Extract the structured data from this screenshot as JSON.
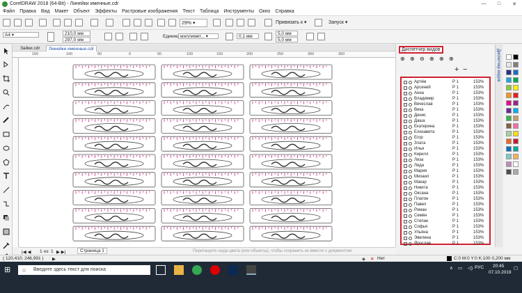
{
  "window": {
    "title": "CorelDRAW 2018 (64-Bit) - Линейки именные.cdr"
  },
  "menu": [
    "Файл",
    "Правка",
    "Вид",
    "Макет",
    "Объект",
    "Эффекты",
    "Растровые изображения",
    "Текст",
    "Таблица",
    "Инструменты",
    "Окно",
    "Справка"
  ],
  "toolbar": {
    "zoom_value": "29%",
    "snap_label": "Привязать к",
    "launch_label": "Запуск"
  },
  "propbar": {
    "page_size": "A4",
    "width": "210,0 мм",
    "height": "297,0 мм",
    "units_label": "Единицы:",
    "units_value": "миллимет...",
    "nudge": "0,1 мм",
    "dup_x": "5,0 мм",
    "dup_y": "5,0 мм"
  },
  "tabs": [
    "Зайки.cdr",
    "Линейки именные.cdr"
  ],
  "ruler_h_ticks": [
    "150",
    "100",
    "50",
    "0",
    "50",
    "100",
    "150",
    "200",
    "250",
    "300",
    "350"
  ],
  "docker": {
    "title": "Диспетчер видов",
    "side_tab": "Диспетчер видов",
    "rows": [
      {
        "name": "Артём",
        "page": "Р 1",
        "zoom": "153%"
      },
      {
        "name": "Арсений",
        "page": "Р 1",
        "zoom": "153%"
      },
      {
        "name": "Анна",
        "page": "Р 1",
        "zoom": "153%"
      },
      {
        "name": "Владимир",
        "page": "Р 1",
        "zoom": "153%"
      },
      {
        "name": "Вячеслав",
        "page": "Р 1",
        "zoom": "153%"
      },
      {
        "name": "Вика",
        "page": "Р 1",
        "zoom": "153%"
      },
      {
        "name": "Денис",
        "page": "Р 1",
        "zoom": "153%"
      },
      {
        "name": "Даша",
        "page": "Р 1",
        "zoom": "153%"
      },
      {
        "name": "Екатерина",
        "page": "Р 1",
        "zoom": "153%"
      },
      {
        "name": "Елизавета",
        "page": "Р 1",
        "zoom": "153%"
      },
      {
        "name": "Егор",
        "page": "Р 1",
        "zoom": "153%"
      },
      {
        "name": "Злата",
        "page": "Р 1",
        "zoom": "153%"
      },
      {
        "name": "Илья",
        "page": "Р 1",
        "zoom": "153%"
      },
      {
        "name": "Кирилл",
        "page": "Р 1",
        "zoom": "153%"
      },
      {
        "name": "Лиза",
        "page": "Р 1",
        "zoom": "153%"
      },
      {
        "name": "Лида",
        "page": "Р 1",
        "zoom": "153%"
      },
      {
        "name": "Мария",
        "page": "Р 1",
        "zoom": "153%"
      },
      {
        "name": "Михаил",
        "page": "Р 1",
        "zoom": "153%"
      },
      {
        "name": "Макар",
        "page": "Р 1",
        "zoom": "153%"
      },
      {
        "name": "Никита",
        "page": "Р 1",
        "zoom": "153%"
      },
      {
        "name": "Оксана",
        "page": "Р 1",
        "zoom": "153%"
      },
      {
        "name": "Платон",
        "page": "Р 1",
        "zoom": "153%"
      },
      {
        "name": "Павел",
        "page": "Р 1",
        "zoom": "153%"
      },
      {
        "name": "Роман",
        "page": "Р 1",
        "zoom": "153%"
      },
      {
        "name": "Семён",
        "page": "Р 1",
        "zoom": "153%"
      },
      {
        "name": "Степан",
        "page": "Р 1",
        "zoom": "153%"
      },
      {
        "name": "Софья",
        "page": "Р 1",
        "zoom": "153%"
      },
      {
        "name": "Ульяна",
        "page": "Р 1",
        "zoom": "153%"
      },
      {
        "name": "Эвелина",
        "page": "Р 1",
        "zoom": "153%"
      },
      {
        "name": "Ярослав",
        "page": "Р 1",
        "zoom": "153%"
      }
    ]
  },
  "page_nav": {
    "current": "1",
    "of_label": "из",
    "total": "1",
    "page_tab": "Страница 1"
  },
  "hint_text": "Перетащите сюда цвета (или объекты), чтобы сохранить их вместе с документом",
  "status": {
    "coords": "( 120,410; 246,991 )",
    "fill_label": "Нет",
    "color_info": "C:0 M:0 Y:0 K:100  0,200 мм"
  },
  "taskbar": {
    "search_placeholder": "Введите здесь текст для поиска",
    "lang": "РУС",
    "time": "20:45",
    "date": "07.10.2019"
  },
  "palette_colors": [
    "#ffffff",
    "#000000",
    "#e5e5e5",
    "#7f7f7f",
    "#2d2d8c",
    "#1c6cc4",
    "#21a4dc",
    "#00a650",
    "#8cc63f",
    "#fff200",
    "#f7941d",
    "#ed1c24",
    "#ec008c",
    "#92278f",
    "#662d91",
    "#00aeef",
    "#39b54a",
    "#c69c6d",
    "#8b5e3c",
    "#f06eaa",
    "#a3d39c",
    "#ffde17",
    "#f26522",
    "#be1e2d",
    "#0072bc",
    "#00a99d",
    "#7accc8",
    "#fbaf5d",
    "#bd8cbf",
    "#ffffff",
    "#4d4d4d",
    "#a7a9ac"
  ]
}
